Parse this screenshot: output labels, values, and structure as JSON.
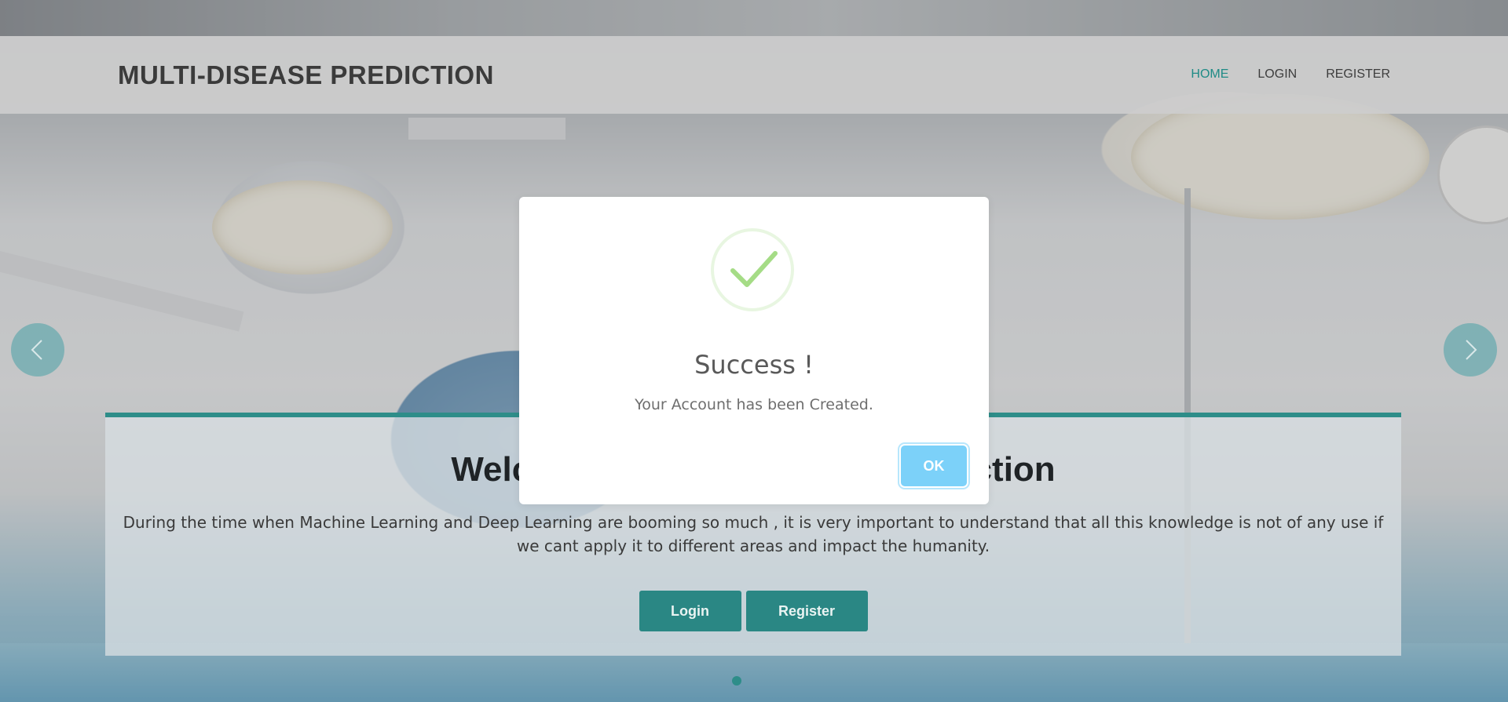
{
  "header": {
    "brand": "MULTI-DISEASE PREDICTION",
    "nav": [
      {
        "label": "HOME",
        "active": true
      },
      {
        "label": "LOGIN",
        "active": false
      },
      {
        "label": "REGISTER",
        "active": false
      }
    ]
  },
  "hero": {
    "title": "Welcome to Multi-Disease Prediction",
    "text": "During the time when Machine Learning and Deep Learning are booming so much , it is very important to understand that all this knowledge is not of any use if we cant apply it to different areas and impact the humanity.",
    "buttons": {
      "login": "Login",
      "register": "Register"
    }
  },
  "carousel": {
    "prev_icon": "chevron-left-icon",
    "next_icon": "chevron-right-icon"
  },
  "modal": {
    "icon": "success-check-icon",
    "title": "Success !",
    "message": "Your Account has been Created.",
    "ok_label": "OK"
  },
  "colors": {
    "accent": "#2e8d89",
    "nav_active": "#1f8b86",
    "ok_button": "#7cd1f9",
    "check": "#a5dc86"
  }
}
